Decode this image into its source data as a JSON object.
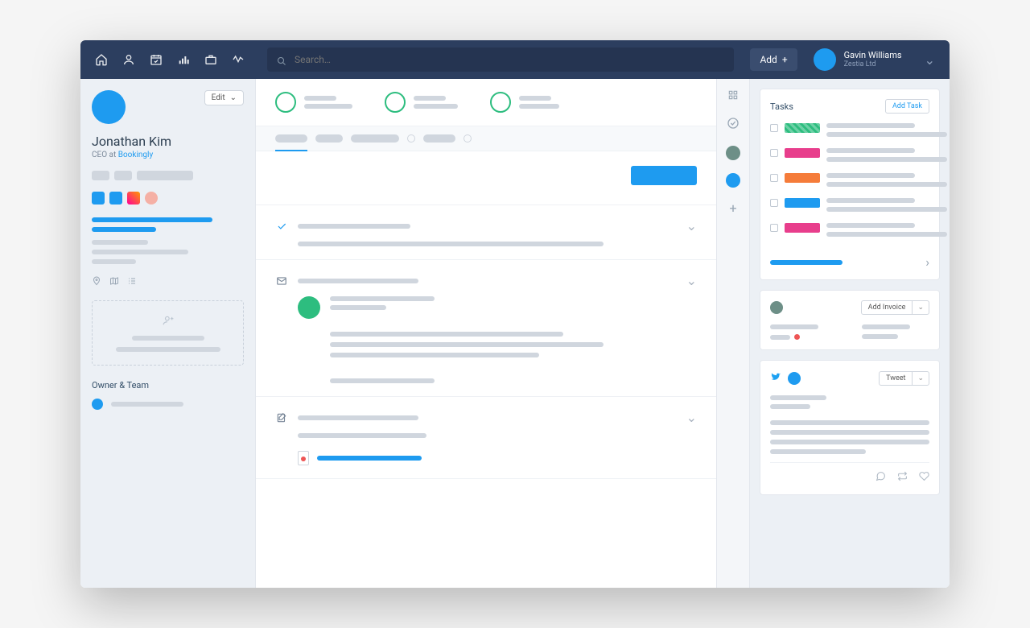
{
  "topbar": {
    "search_placeholder": "Search…",
    "add_label": "Add",
    "user_name": "Gavin Williams",
    "user_company": "Zestia Ltd"
  },
  "profile": {
    "name": "Jonathan Kim",
    "role_prefix": "CEO at ",
    "company": "Bookingly",
    "edit_label": "Edit",
    "owner_team_label": "Owner & Team"
  },
  "tasks": {
    "title": "Tasks",
    "add_label": "Add Task",
    "items": [
      {
        "tag_color": "#2dbd7f",
        "striped": true
      },
      {
        "tag_color": "#e83e8c"
      },
      {
        "tag_color": "#f57c3a"
      },
      {
        "tag_color": "#1e9bf0"
      },
      {
        "tag_color": "#e83e8c"
      }
    ]
  },
  "invoice": {
    "add_label": "Add Invoice"
  },
  "tweet": {
    "button_label": "Tweet"
  }
}
